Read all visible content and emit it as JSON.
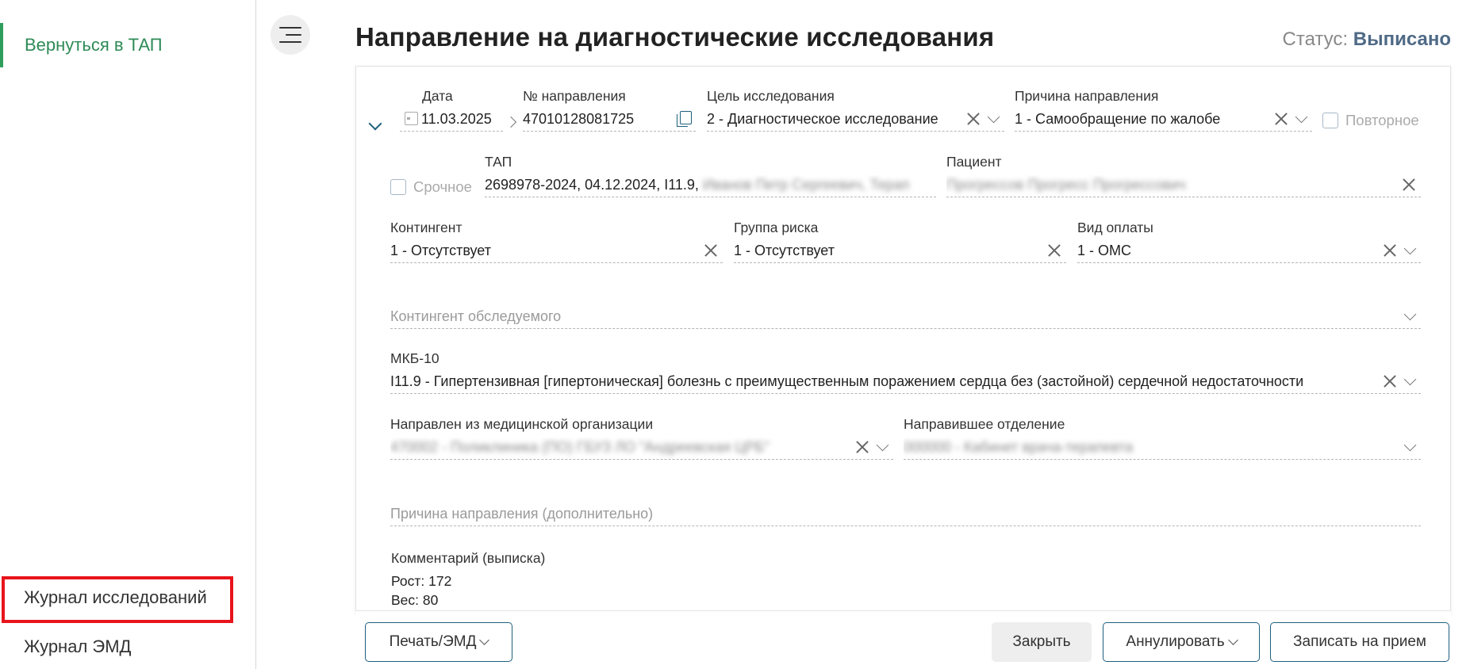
{
  "sidebar": {
    "back_label": "Вернуться в ТАП",
    "journal_studies": "Журнал исследований",
    "journal_emd": "Журнал ЭМД"
  },
  "header": {
    "title": "Направление на диагностические исследования",
    "status_label": "Статус:",
    "status_value": "Выписано"
  },
  "form": {
    "date": {
      "label": "Дата",
      "value": "11.03.2025"
    },
    "number": {
      "label": "№ направления",
      "value": "47010128081725"
    },
    "purpose": {
      "label": "Цель исследования",
      "value": "2 - Диагностическое исследование"
    },
    "reason": {
      "label": "Причина направления",
      "value": "1 - Самообращение по жалобе"
    },
    "repeat": {
      "label": "Повторное",
      "checked": false
    },
    "urgent": {
      "label": "Срочное",
      "checked": false
    },
    "tap": {
      "label": "ТАП",
      "value": "2698978-2024, 04.12.2024, I11.9,",
      "value_hidden": "Иванов Петр Сергеевич, Терап"
    },
    "patient": {
      "label": "Пациент",
      "value_hidden": "Прогрессов Прогресс Прогрессович"
    },
    "contingent": {
      "label": "Контингент",
      "value": "1 - Отсутствует"
    },
    "risk_group": {
      "label": "Группа риска",
      "value": "1 - Отсутствует"
    },
    "payment": {
      "label": "Вид оплаты",
      "value": "1 - ОМС"
    },
    "examined_contingent": {
      "placeholder": "Контингент обследуемого"
    },
    "mkb": {
      "label": "МКБ-10",
      "value": "I11.9 - Гипертензивная [гипертоническая] болезнь с преимущественным поражением сердца без (застойной) сердечной недостаточности"
    },
    "from_org": {
      "label": "Направлен из медицинской организации",
      "value_hidden": "470002 - Поликлиника (ПО) ГБУЗ ЛО \"Андреевская ЦРБ\""
    },
    "from_dept": {
      "label": "Направившее отделение",
      "value_hidden": "000000 - Кабинет врача-терапевта"
    },
    "reason_extra": {
      "placeholder": "Причина направления (дополнительно)"
    },
    "comment": {
      "label": "Комментарий (выписка)",
      "line1": "Рост: 172",
      "line2": "Вес: 80"
    }
  },
  "footer": {
    "print_label": "Печать/ЭМД",
    "close_label": "Закрыть",
    "annul_label": "Аннулировать",
    "appointment_label": "Записать на прием"
  },
  "colors": {
    "accent_green": "#2e8b57",
    "accent_blue": "#1e5f7e",
    "highlight_red": "#e8141b",
    "status_value": "#4f6a86"
  },
  "icons": [
    "calendar-icon",
    "chevron-right-icon",
    "copy-icon",
    "clear-icon",
    "chevron-down-icon",
    "menu-icon"
  ]
}
